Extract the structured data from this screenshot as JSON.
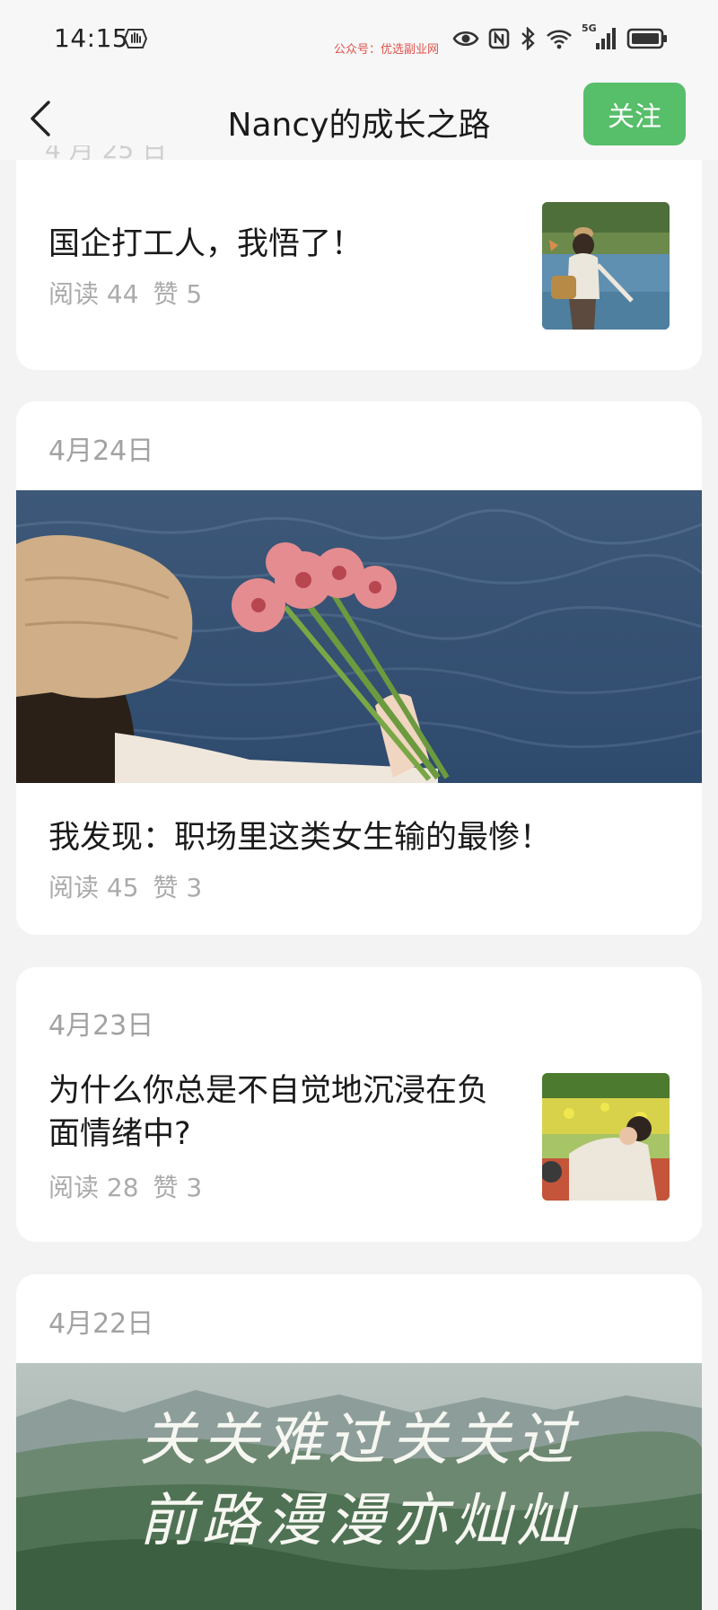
{
  "status_bar": {
    "time": "14:15",
    "watermark": "公众号：优选副业网",
    "network": "5G",
    "icons": [
      "hand-icon",
      "eye-icon",
      "nfc-icon",
      "bluetooth-icon",
      "wifi-icon",
      "signal-icon",
      "battery-icon"
    ]
  },
  "nav": {
    "title": "Nancy的成长之路",
    "follow_label": "关注",
    "accent_color": "#57be6a"
  },
  "articles": [
    {
      "date": "",
      "title": "国企打工人，我悟了！",
      "reads": "阅读 44",
      "likes": "赞 5",
      "image": "thumbnail-woman-by-lake"
    },
    {
      "date": "4月24日",
      "title": "我发现：职场里这类女生输的最惨！",
      "reads": "阅读 45",
      "likes": "赞 3",
      "image": "cover-woman-holding-flowers"
    },
    {
      "date": "4月23日",
      "title_line1": "为什么你总是不自觉地沉浸在负",
      "title_line2": "面情绪中?",
      "reads": "阅读 28",
      "likes": "赞 3",
      "image": "thumbnail-woman-in-field"
    },
    {
      "date": "4月22日",
      "cover_text_line1": "关关难过关关过",
      "cover_text_line2": "前路漫漫亦灿灿",
      "image": "cover-mountain-landscape"
    }
  ]
}
